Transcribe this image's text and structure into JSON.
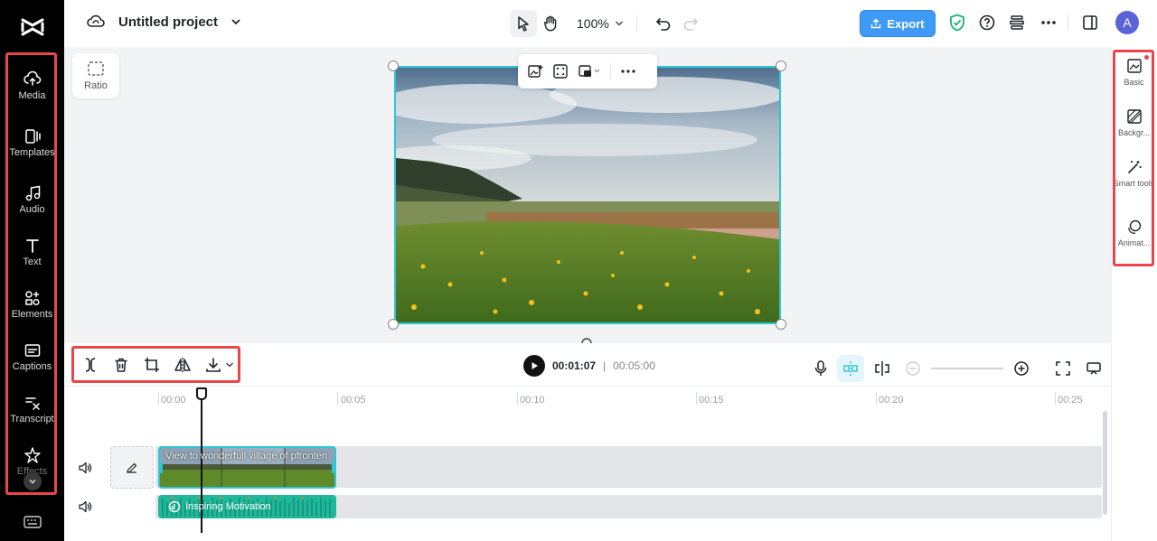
{
  "header": {
    "project_title": "Untitled project",
    "zoom": "100%",
    "export_label": "Export",
    "avatar_initial": "A"
  },
  "sidebar": {
    "items": [
      {
        "label": "Media",
        "icon": "cloud-upload-icon"
      },
      {
        "label": "Templates",
        "icon": "templates-icon"
      },
      {
        "label": "Audio",
        "icon": "music-note-icon"
      },
      {
        "label": "Text",
        "icon": "text-icon"
      },
      {
        "label": "Elements",
        "icon": "elements-icon"
      },
      {
        "label": "Captions",
        "icon": "captions-icon"
      },
      {
        "label": "Transcript",
        "icon": "transcript-icon"
      },
      {
        "label": "Effects",
        "icon": "effects-icon"
      }
    ]
  },
  "canvas": {
    "ratio_label": "Ratio"
  },
  "right_panel": {
    "items": [
      {
        "label": "Basic",
        "icon": "basic-icon"
      },
      {
        "label": "Backgr...",
        "icon": "background-icon"
      },
      {
        "label": "Smart tools",
        "icon": "magic-wand-icon"
      },
      {
        "label": "Animat...",
        "icon": "animation-icon"
      }
    ]
  },
  "timeline": {
    "current_time": "00:01:07",
    "separator": "|",
    "total_time": "00:05:00",
    "ruler_labels": [
      "00:00",
      "00:05",
      "00:10",
      "00:15",
      "00:20",
      "00:25"
    ],
    "video_clip_title": "View to wonderfull village of pfronten",
    "audio_clip_title": "Inspiring Motivation"
  },
  "colors": {
    "accent": "#2ec6d4",
    "export": "#3e9af5",
    "highlight": "#e8464b",
    "audio": "#1fb89a"
  }
}
